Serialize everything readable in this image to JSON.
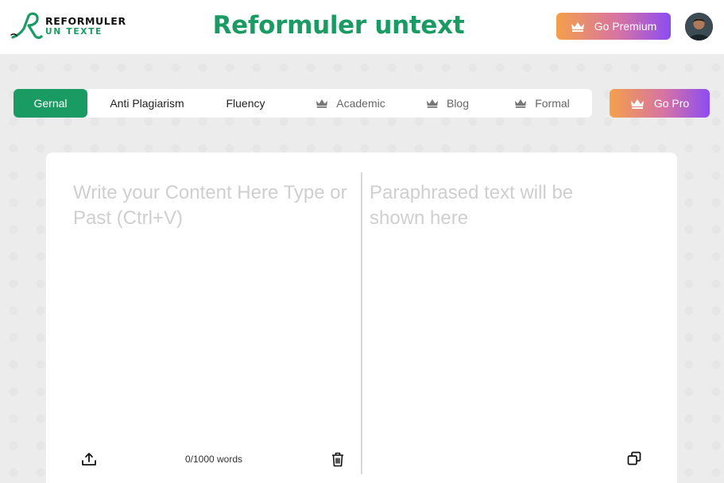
{
  "header": {
    "logo_line1": "REFORMULER",
    "logo_line2": "UN TEXTE",
    "title": "Reformuler untext",
    "premium_label": "Go Premium"
  },
  "tabs": [
    {
      "label": "Gernal",
      "active": true,
      "locked": false
    },
    {
      "label": "Anti Plagiarism",
      "active": false,
      "locked": false
    },
    {
      "label": "Fluency",
      "active": false,
      "locked": false
    },
    {
      "label": "Academic",
      "active": false,
      "locked": true
    },
    {
      "label": "Blog",
      "active": false,
      "locked": true
    },
    {
      "label": "Formal",
      "active": false,
      "locked": true
    }
  ],
  "pro_label": "Go Pro",
  "editor": {
    "input_placeholder": "Write your Content Here Type or Past (Ctrl+V)",
    "input_value": "",
    "output_placeholder": "Paraphrased text will be shown here",
    "word_count": "0/1000 words"
  },
  "colors": {
    "brand": "#1a9b63",
    "gradient_start": "#f4a04b",
    "gradient_end": "#8c4cf2",
    "page_bg": "#ececec"
  },
  "icons": {
    "premium": "crown-icon",
    "upload": "upload-icon",
    "delete": "trash-icon",
    "copy": "copy-icon"
  }
}
